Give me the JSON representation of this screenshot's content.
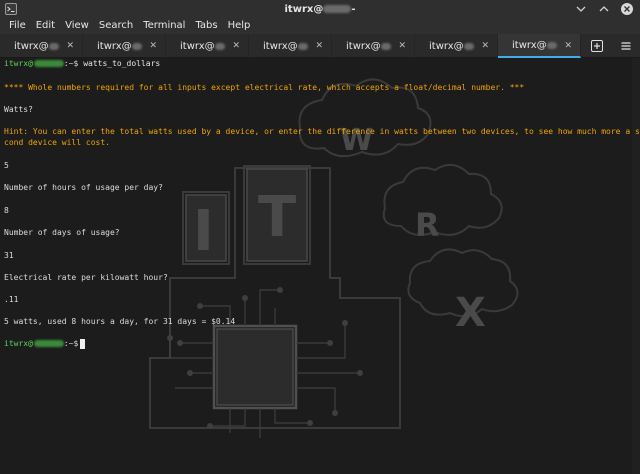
{
  "window": {
    "title": "itwrx@",
    "title_suffix": "-"
  },
  "menu": {
    "items": [
      "File",
      "Edit",
      "View",
      "Search",
      "Terminal",
      "Tabs",
      "Help"
    ]
  },
  "tabs": [
    {
      "label": "itwrx@"
    },
    {
      "label": "itwrx@"
    },
    {
      "label": "itwrx@"
    },
    {
      "label": "itwrx@"
    },
    {
      "label": "itwrx@"
    },
    {
      "label": "itwrx@"
    },
    {
      "label": "itwrx@",
      "active": true
    }
  ],
  "terminal": {
    "prompt_user": "itwrx@",
    "prompt_suffix": ":~$",
    "command": "watts_to_dollars",
    "notice": "**** Whole numbers required for all inputs except electrical rate, which accepts a float/decimal number. ***",
    "q_watts": "Watts?",
    "hint_1": "Hint: You can enter the total watts used by a device, or enter the difference in watts between two devices, to see how much more a se",
    "hint_2": "cond device will cost.",
    "a_watts": "5",
    "q_hours": "Number of hours of usage per day?",
    "a_hours": "8",
    "q_days": "Number of days of usage?",
    "a_days": "31",
    "q_rate": "Electrical rate per kilowatt hour?",
    "a_rate": ".11",
    "result": "5 watts, used 8 hours a day, for 31 days = $0.14"
  },
  "colors": {
    "prompt": "#5fd35f",
    "warning": "#f0a500",
    "active_tab_accent": "#3daee9",
    "background": "#1c1c1c"
  },
  "icons": {
    "app": "terminal-app-icon",
    "new_tab": "new-tab-icon",
    "menu": "hamburger-menu-icon"
  }
}
